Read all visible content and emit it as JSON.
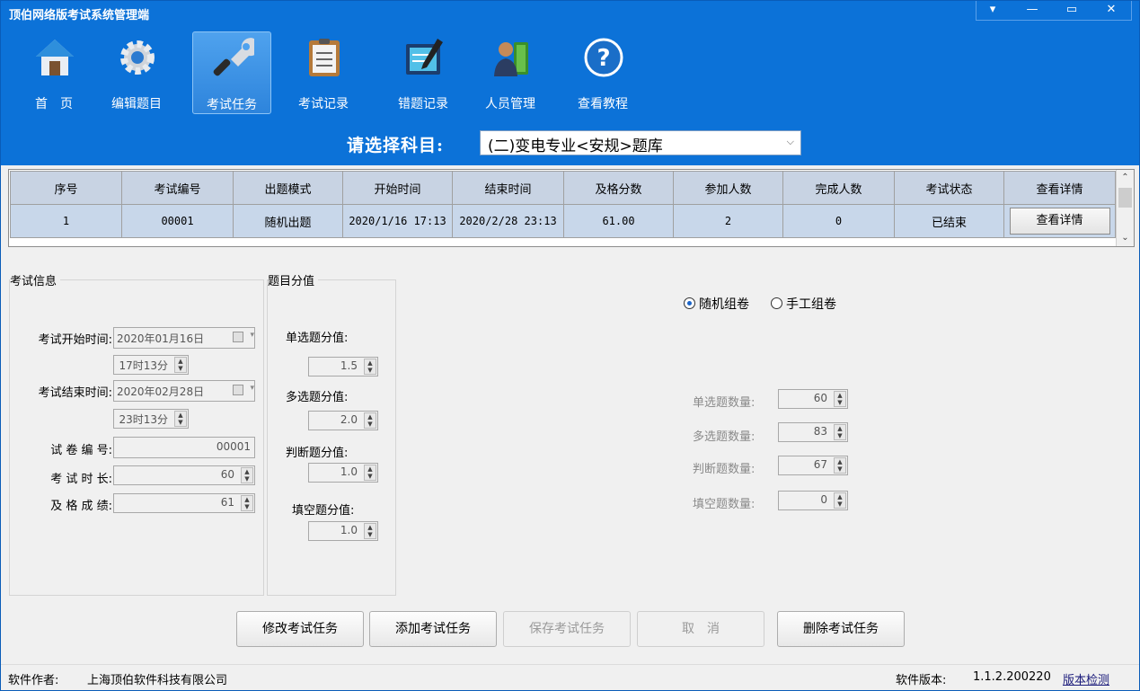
{
  "window": {
    "title": "顶伯网络版考试系统管理端",
    "controls": [
      "▾",
      "—",
      "▭",
      "✕"
    ]
  },
  "toolbar": {
    "items": [
      {
        "label": "首　页",
        "icon": "home-icon"
      },
      {
        "label": "编辑题目",
        "icon": "gear-icon"
      },
      {
        "label": "考试任务",
        "icon": "wrench-icon",
        "active": true
      },
      {
        "label": "考试记录",
        "icon": "clipboard-icon"
      },
      {
        "label": "错题记录",
        "icon": "notebook-pen-icon"
      },
      {
        "label": "人员管理",
        "icon": "person-book-icon"
      },
      {
        "label": "查看教程",
        "icon": "help-icon"
      }
    ]
  },
  "subject": {
    "label": "请选择科目:",
    "selected": "(二)变电专业<安规>题库"
  },
  "grid": {
    "headers": [
      "序号",
      "考试编号",
      "出题模式",
      "开始时间",
      "结束时间",
      "及格分数",
      "参加人数",
      "完成人数",
      "考试状态",
      "查看详情"
    ],
    "rows": [
      [
        "1",
        "00001",
        "随机出题",
        "2020/1/16 17:13",
        "2020/2/28 23:13",
        "61.00",
        "2",
        "0",
        "已结束",
        "查看详情"
      ]
    ]
  },
  "exam_info": {
    "title": "考试信息",
    "start_label": "考试开始时间:",
    "start_date": "2020年01月16日",
    "start_time": "17时13分",
    "end_label": "考试结束时间:",
    "end_date": "2020年02月28日",
    "end_time": "23时13分",
    "paper_label": "试 卷 编 号:",
    "paper_value": "00001",
    "duration_label": "考 试 时 长:",
    "duration_value": "60",
    "pass_label": "及 格 成 绩:",
    "pass_value": "61"
  },
  "scores": {
    "title": "题目分值",
    "single_label": "单选题分值:",
    "single_value": "1.5",
    "multi_label": "多选题分值:",
    "multi_value": "2.0",
    "judge_label": "判断题分值:",
    "judge_value": "1.0",
    "fill_label": "填空题分值:",
    "fill_value": "1.0"
  },
  "compose": {
    "random_label": "随机组卷",
    "manual_label": "手工组卷",
    "selected": "random",
    "single_count_label": "单选题数量:",
    "single_count": "60",
    "multi_count_label": "多选题数量:",
    "multi_count": "83",
    "judge_count_label": "判断题数量:",
    "judge_count": "67",
    "fill_count_label": "填空题数量:",
    "fill_count": "0"
  },
  "buttons": {
    "modify": "修改考试任务",
    "add": "添加考试任务",
    "save": "保存考试任务",
    "cancel": "取　消",
    "delete": "删除考试任务"
  },
  "status": {
    "author_label": "软件作者:",
    "author": "上海顶伯软件科技有限公司",
    "version_label": "软件版本:",
    "version": "1.1.2.200220",
    "check": "版本检测"
  },
  "colors": {
    "band": "#0c72d8",
    "row_selected": "#c8d7ea",
    "header": "#c8d3e3"
  }
}
